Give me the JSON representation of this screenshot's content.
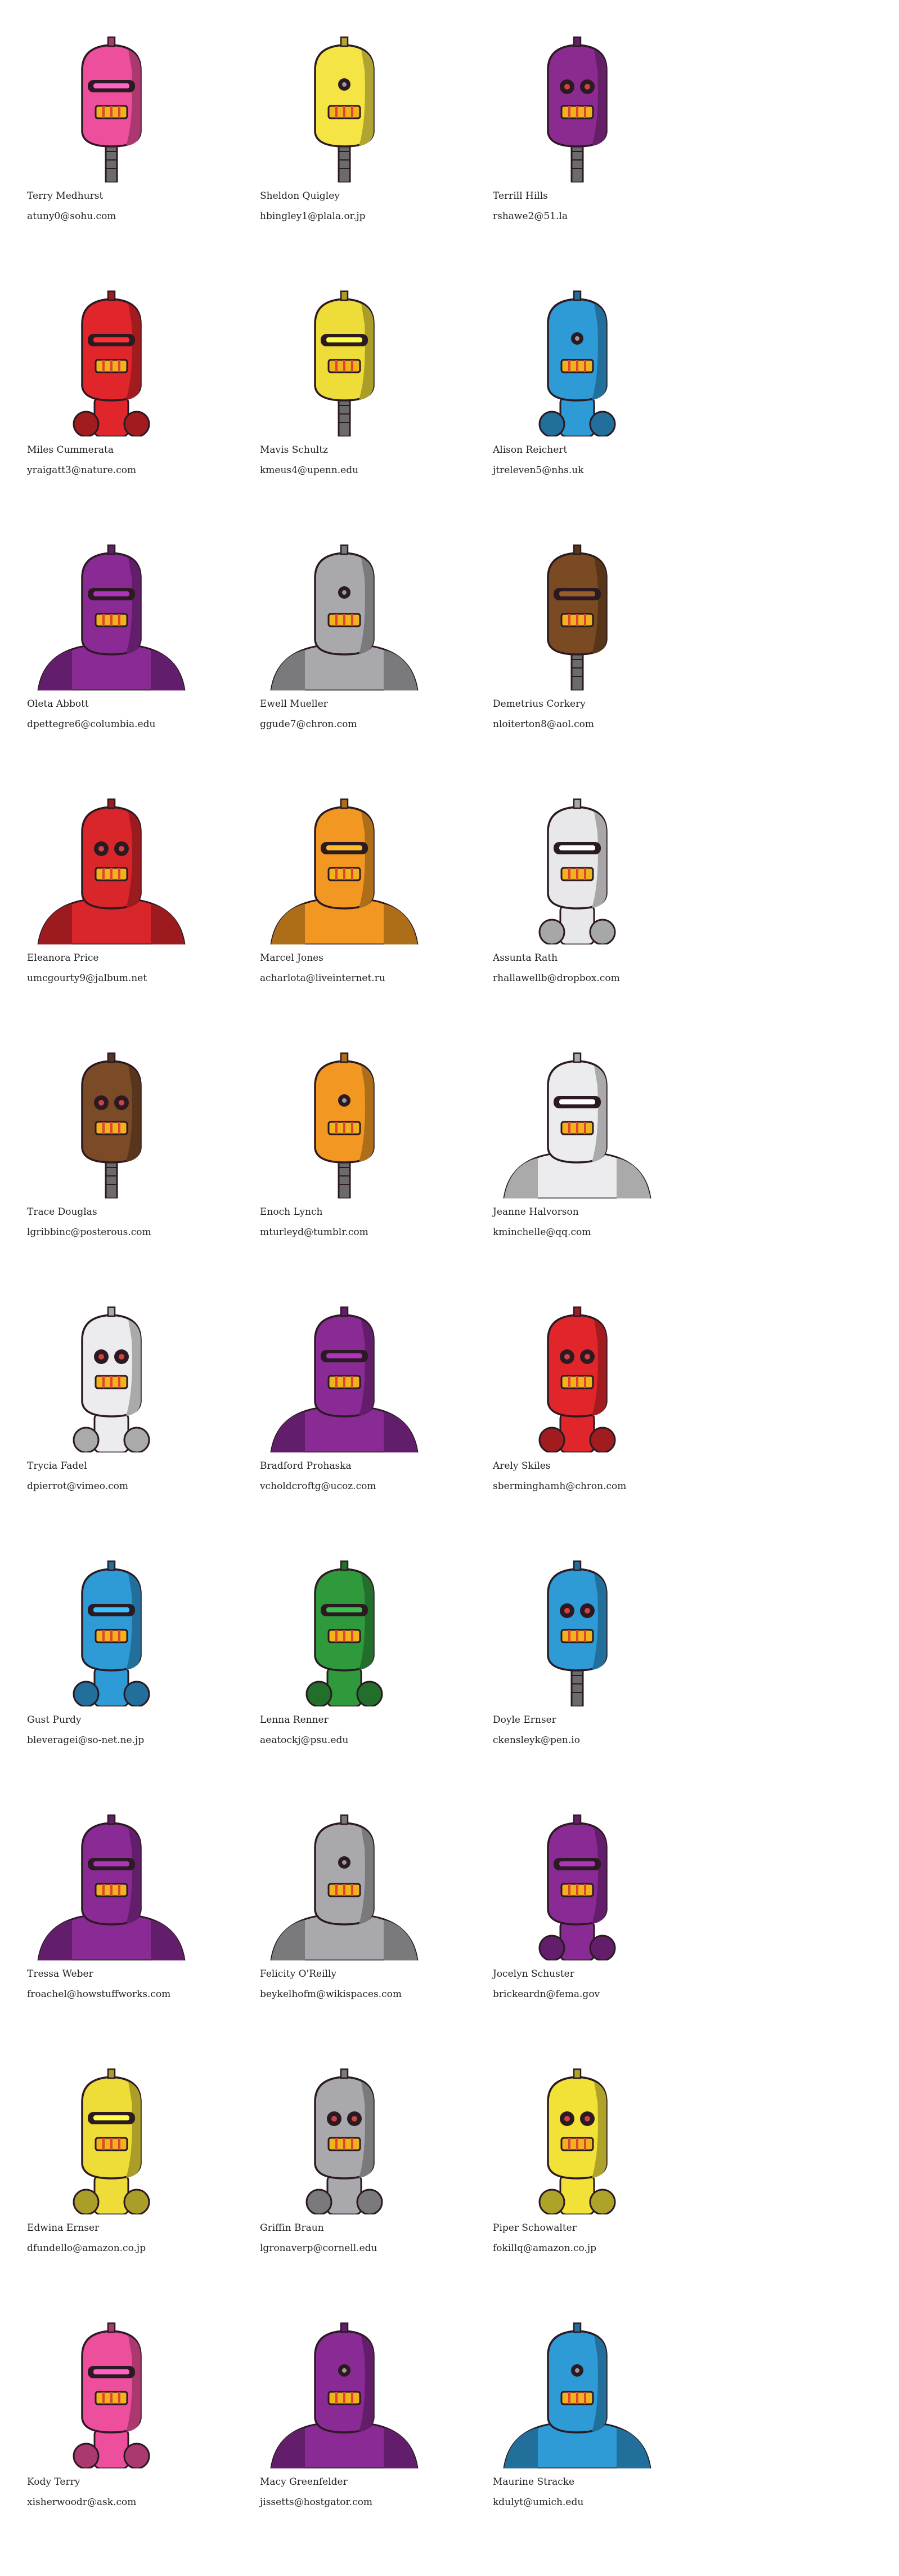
{
  "people": [
    {
      "name": "Terry Medhurst",
      "email": "atuny0@sohu.com",
      "avatar_icon": "robot-avatar-icon",
      "color": "#ee4f9c",
      "body": "thin",
      "eyes": "visor"
    },
    {
      "name": "Sheldon Quigley",
      "email": "hbingley1@plala.or.jp",
      "avatar_icon": "robot-avatar-icon",
      "color": "#f4e544",
      "body": "thin",
      "eyes": "single"
    },
    {
      "name": "Terrill Hills",
      "email": "rshawe2@51.la",
      "avatar_icon": "robot-avatar-icon",
      "color": "#8c2b8f",
      "body": "thin",
      "eyes": "round"
    },
    {
      "name": "Miles Cummerata",
      "email": "yraigatt3@nature.com",
      "avatar_icon": "robot-avatar-icon",
      "color": "#e0262b",
      "body": "arms",
      "eyes": "visor"
    },
    {
      "name": "Mavis Schultz",
      "email": "kmeus4@upenn.edu",
      "avatar_icon": "robot-avatar-icon",
      "color": "#eedc38",
      "body": "thin",
      "eyes": "visor"
    },
    {
      "name": "Alison Reichert",
      "email": "jtreleven5@nhs.uk",
      "avatar_icon": "robot-avatar-icon",
      "color": "#2e9ad6",
      "body": "arms",
      "eyes": "single"
    },
    {
      "name": "Oleta Abbott",
      "email": "dpettegre6@columbia.edu",
      "avatar_icon": "robot-avatar-icon",
      "color": "#8a2a95",
      "body": "wide",
      "eyes": "visor"
    },
    {
      "name": "Ewell Mueller",
      "email": "ggude7@chron.com",
      "avatar_icon": "robot-avatar-icon",
      "color": "#a9a9ad",
      "body": "wide",
      "eyes": "single"
    },
    {
      "name": "Demetrius Corkery",
      "email": "nloiterton8@aol.com",
      "avatar_icon": "robot-avatar-icon",
      "color": "#7a4a22",
      "body": "thin",
      "eyes": "visor"
    },
    {
      "name": "Eleanora Price",
      "email": "umcgourty9@jalbum.net",
      "avatar_icon": "robot-avatar-icon",
      "color": "#d8262a",
      "body": "wide",
      "eyes": "round"
    },
    {
      "name": "Marcel Jones",
      "email": "acharlota@liveinternet.ru",
      "avatar_icon": "robot-avatar-icon",
      "color": "#f19722",
      "body": "wide",
      "eyes": "visor"
    },
    {
      "name": "Assunta Rath",
      "email": "rhallawellb@dropbox.com",
      "avatar_icon": "robot-avatar-icon",
      "color": "#e8e8ea",
      "body": "arms",
      "eyes": "visor"
    },
    {
      "name": "Trace Douglas",
      "email": "lgribbinc@posterous.com",
      "avatar_icon": "robot-avatar-icon",
      "color": "#7b4a26",
      "body": "thin",
      "eyes": "round"
    },
    {
      "name": "Enoch Lynch",
      "email": "mturleyd@tumblr.com",
      "avatar_icon": "robot-avatar-icon",
      "color": "#f19722",
      "body": "thin",
      "eyes": "single"
    },
    {
      "name": "Jeanne Halvorson",
      "email": "kminchelle@qq.com",
      "avatar_icon": "robot-avatar-icon",
      "color": "#ececee",
      "body": "wide",
      "eyes": "visor"
    },
    {
      "name": "Trycia Fadel",
      "email": "dpierrot@vimeo.com",
      "avatar_icon": "robot-avatar-icon",
      "color": "#ececee",
      "body": "arms",
      "eyes": "round"
    },
    {
      "name": "Bradford Prohaska",
      "email": "vcholdcroftg@ucoz.com",
      "avatar_icon": "robot-avatar-icon",
      "color": "#8a2a95",
      "body": "wide",
      "eyes": "visor"
    },
    {
      "name": "Arely Skiles",
      "email": "sberminghamh@chron.com",
      "avatar_icon": "robot-avatar-icon",
      "color": "#e0262b",
      "body": "arms",
      "eyes": "round"
    },
    {
      "name": "Gust Purdy",
      "email": "bleveragei@so-net.ne.jp",
      "avatar_icon": "robot-avatar-icon",
      "color": "#2e9ad6",
      "body": "arms",
      "eyes": "visor"
    },
    {
      "name": "Lenna Renner",
      "email": "aeatockj@psu.edu",
      "avatar_icon": "robot-avatar-icon",
      "color": "#2f9a3c",
      "body": "arms",
      "eyes": "visor"
    },
    {
      "name": "Doyle Ernser",
      "email": "ckensleyk@pen.io",
      "avatar_icon": "robot-avatar-icon",
      "color": "#2e9ad6",
      "body": "thin",
      "eyes": "round"
    },
    {
      "name": "Tressa Weber",
      "email": "froachel@howstuffworks.com",
      "avatar_icon": "robot-avatar-icon",
      "color": "#8a2a95",
      "body": "wide",
      "eyes": "visor"
    },
    {
      "name": "Felicity O'Reilly",
      "email": "beykelhofm@wikispaces.com",
      "avatar_icon": "robot-avatar-icon",
      "color": "#a9a9ad",
      "body": "wide",
      "eyes": "single"
    },
    {
      "name": "Jocelyn Schuster",
      "email": "brickeardn@fema.gov",
      "avatar_icon": "robot-avatar-icon",
      "color": "#8a2a95",
      "body": "arms",
      "eyes": "visor"
    },
    {
      "name": "Edwina Ernser",
      "email": "dfundello@amazon.co.jp",
      "avatar_icon": "robot-avatar-icon",
      "color": "#eedc38",
      "body": "arms",
      "eyes": "visor"
    },
    {
      "name": "Griffin Braun",
      "email": "lgronaverp@cornell.edu",
      "avatar_icon": "robot-avatar-icon",
      "color": "#a9a9ad",
      "body": "arms",
      "eyes": "round"
    },
    {
      "name": "Piper Schowalter",
      "email": "fokillq@amazon.co.jp",
      "avatar_icon": "robot-avatar-icon",
      "color": "#f2e238",
      "body": "arms",
      "eyes": "round"
    },
    {
      "name": "Kody Terry",
      "email": "xisherwoodr@ask.com",
      "avatar_icon": "robot-avatar-icon",
      "color": "#ee4f9c",
      "body": "arms",
      "eyes": "visor"
    },
    {
      "name": "Macy Greenfelder",
      "email": "jissetts@hostgator.com",
      "avatar_icon": "robot-avatar-icon",
      "color": "#8a2a95",
      "body": "wide",
      "eyes": "single"
    },
    {
      "name": "Maurine Stracke",
      "email": "kdulyt@umich.edu",
      "avatar_icon": "robot-avatar-icon",
      "color": "#2e9ad6",
      "body": "wide",
      "eyes": "single"
    }
  ]
}
